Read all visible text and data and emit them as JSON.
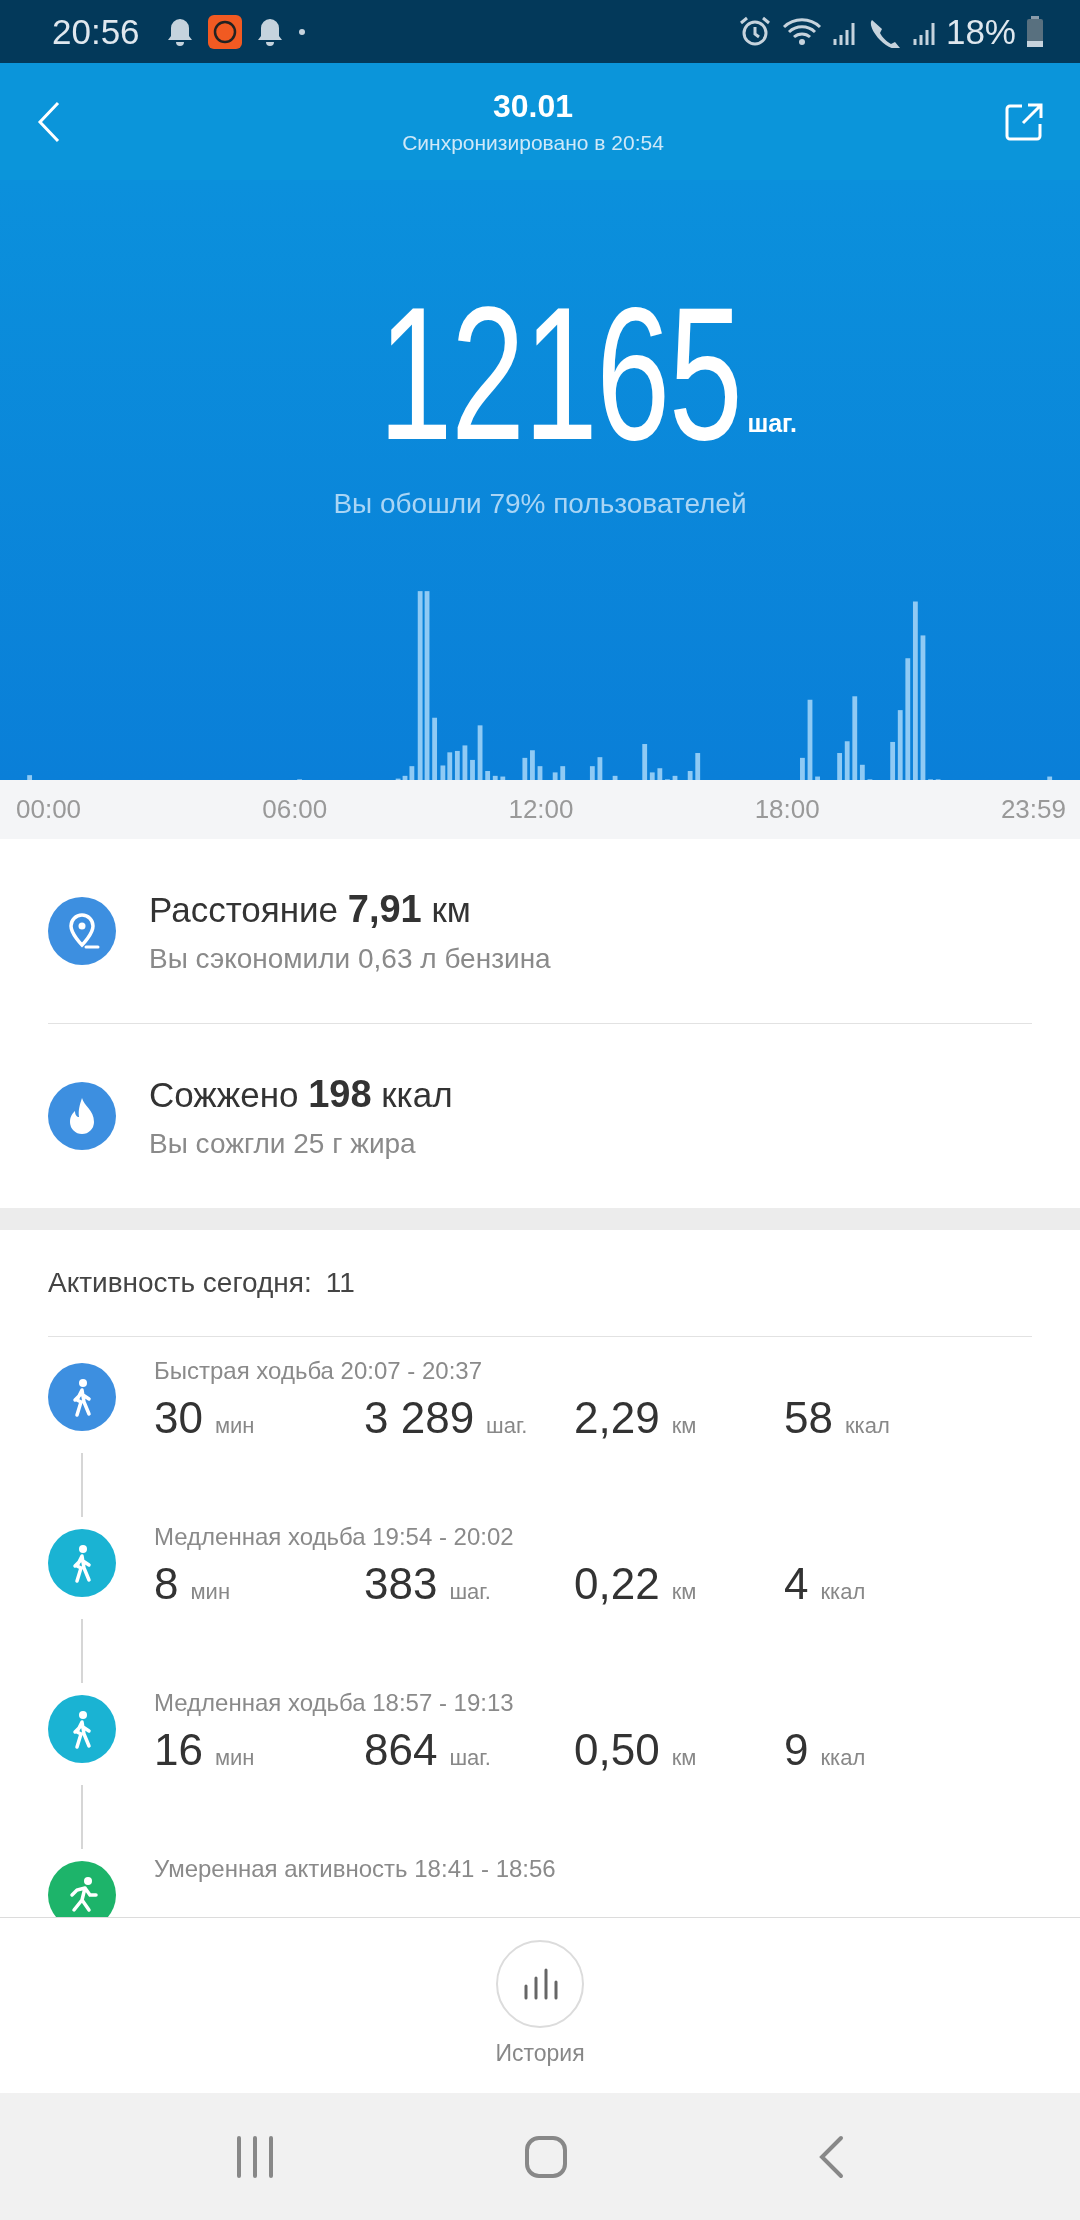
{
  "status_bar": {
    "time": "20:56",
    "battery": "18%"
  },
  "header": {
    "title": "30.01",
    "subtitle": "Синхронизировано в 20:54"
  },
  "summary": {
    "steps": "12165",
    "unit": "шаг.",
    "caption": "Вы обошли 79% пользователей"
  },
  "chart": {
    "axis_labels": [
      "00:00",
      "06:00",
      "12:00",
      "18:00",
      "23:59"
    ]
  },
  "stats": [
    {
      "kind": "distance",
      "text": "Расстояние **7,91** км",
      "note": "Вы сэкономили 0,63 л бензина"
    },
    {
      "kind": "calories",
      "text": "Сожжено **198** ккал",
      "note": "Вы сожгли 25 г жира"
    }
  ],
  "activity": {
    "label": "Активность сегодня:",
    "count": "11",
    "items": [
      {
        "kind": "walk",
        "color": "#3d8fe0",
        "title": "Быстрая ходьба 20:07 - 20:37",
        "metrics": [
          {
            "value": "30",
            "unit": "мин"
          },
          {
            "value": "3 289",
            "unit": "шаг."
          },
          {
            "value": "2,29",
            "unit": "км"
          },
          {
            "value": "58",
            "unit": "ккал"
          }
        ]
      },
      {
        "kind": "walk",
        "color": "#1ab3d3",
        "title": "Медленная ходьба 19:54 - 20:02",
        "metrics": [
          {
            "value": "8",
            "unit": "мин"
          },
          {
            "value": "383",
            "unit": "шаг."
          },
          {
            "value": "0,22",
            "unit": "км"
          },
          {
            "value": "4",
            "unit": "ккал"
          }
        ]
      },
      {
        "kind": "walk",
        "color": "#1ab3d3",
        "title": "Медленная ходьба 18:57 - 19:13",
        "metrics": [
          {
            "value": "16",
            "unit": "мин"
          },
          {
            "value": "864",
            "unit": "шаг."
          },
          {
            "value": "0,50",
            "unit": "км"
          },
          {
            "value": "9",
            "unit": "ккал"
          }
        ]
      },
      {
        "kind": "run",
        "color": "#1db46a",
        "title": "Умеренная активность 18:41 - 18:56"
      }
    ]
  },
  "bottom": {
    "history": "История"
  }
}
